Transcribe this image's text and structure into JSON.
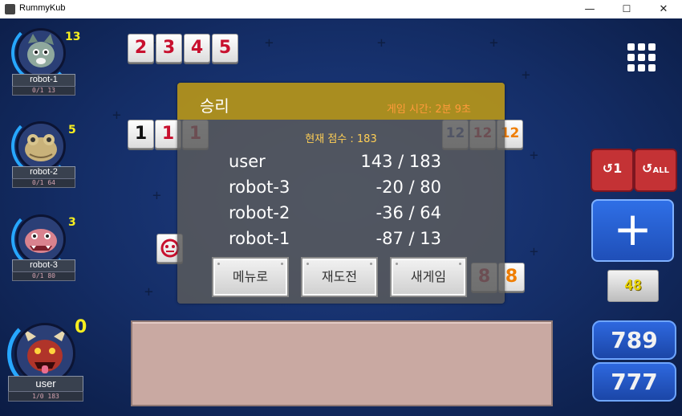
{
  "window": {
    "title": "RummyKub",
    "controls": {
      "minimize": "—",
      "maximize": "☐",
      "close": "✕"
    }
  },
  "players": [
    {
      "name": "robot-1",
      "stats": "0/1 13",
      "tiles": "13",
      "avatar": "cat-avatar"
    },
    {
      "name": "robot-2",
      "stats": "0/1 64",
      "tiles": "5",
      "avatar": "frog-avatar"
    },
    {
      "name": "robot-3",
      "stats": "0/1 80",
      "tiles": "3",
      "avatar": "dragon-avatar"
    },
    {
      "name": "user",
      "stats": "1/0 183",
      "tiles": "0",
      "avatar": "demon-avatar"
    }
  ],
  "board_sets": [
    {
      "name": "set-red-run",
      "tiles": [
        {
          "v": "2",
          "c": "red"
        },
        {
          "v": "3",
          "c": "red"
        },
        {
          "v": "4",
          "c": "red"
        },
        {
          "v": "5",
          "c": "red"
        }
      ]
    },
    {
      "name": "set-mixed-ones",
      "tiles": [
        {
          "v": "1",
          "c": "blk"
        },
        {
          "v": "1",
          "c": "red"
        },
        {
          "v": "1",
          "c": "red"
        }
      ]
    },
    {
      "name": "set-twelves",
      "tiles": [
        {
          "v": "12",
          "c": "blu"
        },
        {
          "v": "12",
          "c": "red"
        },
        {
          "v": "12",
          "c": "org"
        }
      ]
    },
    {
      "name": "set-bottom-right",
      "tiles": [
        {
          "v": "8",
          "c": "red"
        },
        {
          "v": "8",
          "c": "org"
        }
      ]
    }
  ],
  "result_dialog": {
    "title": "승리",
    "game_time": "게임 시간: 2분 9초",
    "current_score": "현재 점수 : 183",
    "rows": [
      {
        "name": "user",
        "score": "143 / 183"
      },
      {
        "name": "robot-3",
        "score": "-20 / 80"
      },
      {
        "name": "robot-2",
        "score": "-36 / 64"
      },
      {
        "name": "robot-1",
        "score": "-87 / 13"
      }
    ],
    "buttons": {
      "menu": "메뉴로",
      "retry": "재도전",
      "new_game": "새게임"
    }
  },
  "controls": {
    "undo_one": "1",
    "undo_all": "ALL",
    "draw": "+",
    "pool_count": "48",
    "sort_789": "789",
    "sort_777": "777"
  },
  "colors": {
    "board": "#1a3a80",
    "accent_yellow": "#f6ee1f",
    "tile_red": "#c8102e",
    "tile_blue": "#1f3c9a",
    "tile_orange": "#ef7d00",
    "dialog_header": "#b8961a"
  }
}
